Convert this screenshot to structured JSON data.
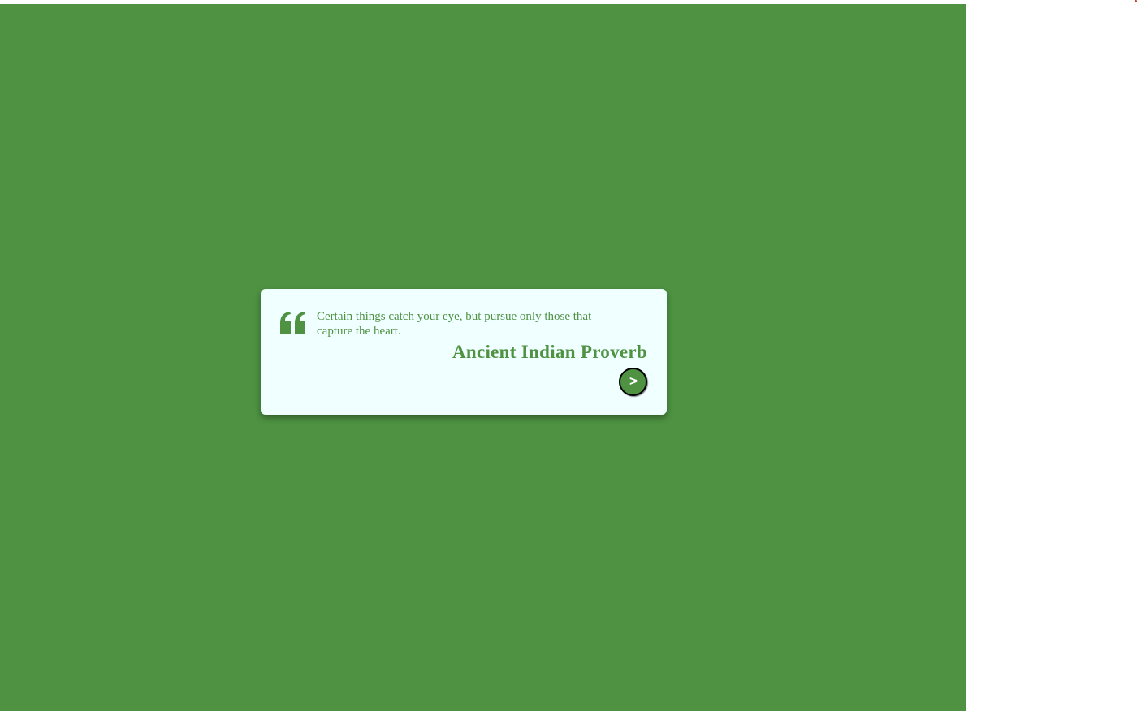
{
  "quote": {
    "text": "Certain things catch your eye, but pursue only those that capture the heart.",
    "author": "Ancient Indian Proverb",
    "icon": "quote-left-icon"
  },
  "controls": {
    "next_label": ">"
  },
  "colors": {
    "accent": "#4e9242",
    "card_background": "#f0ffff",
    "page_background": "#ffffff"
  }
}
